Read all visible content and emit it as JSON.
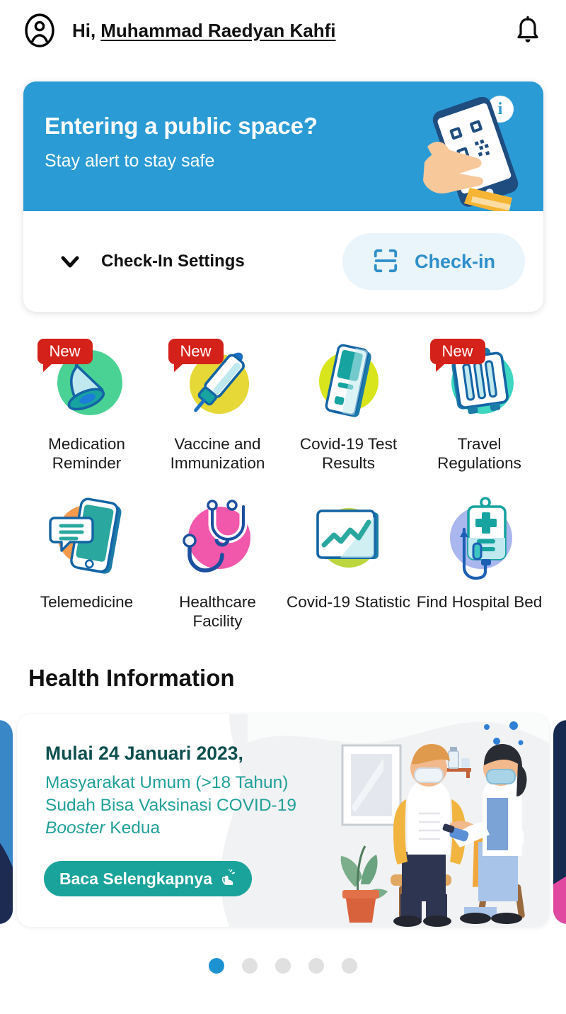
{
  "header": {
    "greeting_prefix": "Hi,",
    "user_name": "Muhammad Raedyan Kahfi",
    "avatar_icon": "account-circle-icon",
    "notification_icon": "bell-icon"
  },
  "checkin_card": {
    "banner": {
      "title": "Entering a public space?",
      "subtitle": "Stay alert to stay safe",
      "info_icon": "info-icon",
      "illustration": "hand-holding-phone-qr-scan",
      "background_color": "#2b9bd6"
    },
    "settings_label": "Check-In Settings",
    "settings_chevron_icon": "chevron-down-icon",
    "checkin_button": {
      "label": "Check-in",
      "icon": "scan-frame-icon",
      "text_color": "#2f8fcc",
      "background_color": "#e9f4fb"
    }
  },
  "features": {
    "new_badge_label": "New",
    "items": [
      {
        "label": "Medication Reminder",
        "icon": "bell-medication-icon",
        "circle_color": "#4ad295",
        "badge": true
      },
      {
        "label": "Vaccine and Immunization",
        "icon": "syringe-icon",
        "circle_color": "#e5d837",
        "badge": true
      },
      {
        "label": "Covid-19 Test Results",
        "icon": "test-kit-icon",
        "circle_color": "#d8e41c",
        "badge": false
      },
      {
        "label": "Travel Regulations",
        "icon": "suitcase-icon",
        "circle_color": "#3ed6c0",
        "badge": true
      },
      {
        "label": "Telemedicine",
        "icon": "phone-chat-icon",
        "circle_color": "#f79a4b",
        "badge": false
      },
      {
        "label": "Healthcare Facility",
        "icon": "stethoscope-icon",
        "circle_color": "#f157ab",
        "badge": false
      },
      {
        "label": "Covid-19 Statistic",
        "icon": "chart-screen-icon",
        "circle_color": "#bcd640",
        "badge": false
      },
      {
        "label": "Find Hospital Bed",
        "icon": "iv-bag-icon",
        "circle_color": "#aab6ee",
        "badge": false
      }
    ]
  },
  "health_information": {
    "section_title": "Health Information",
    "card": {
      "headline": "Mulai 24 Januari 2023,",
      "line1": "Masyarakat Umum (>18 Tahun)",
      "line2": "Sudah Bisa Vaksinasi COVID-19",
      "line3_italic": "Booster",
      "line3_rest": " Kedua",
      "button_label": "Baca Selengkapnya",
      "button_icon": "tap-hand-icon",
      "button_color": "#1aa39a",
      "headline_color": "#0d4f4e",
      "body_color": "#21a098",
      "illustration": "nurse-vaccinating-patient"
    },
    "pager": {
      "total": 5,
      "active_index": 0,
      "active_color": "#1c92d2",
      "inactive_color": "#e0e0e0"
    }
  }
}
